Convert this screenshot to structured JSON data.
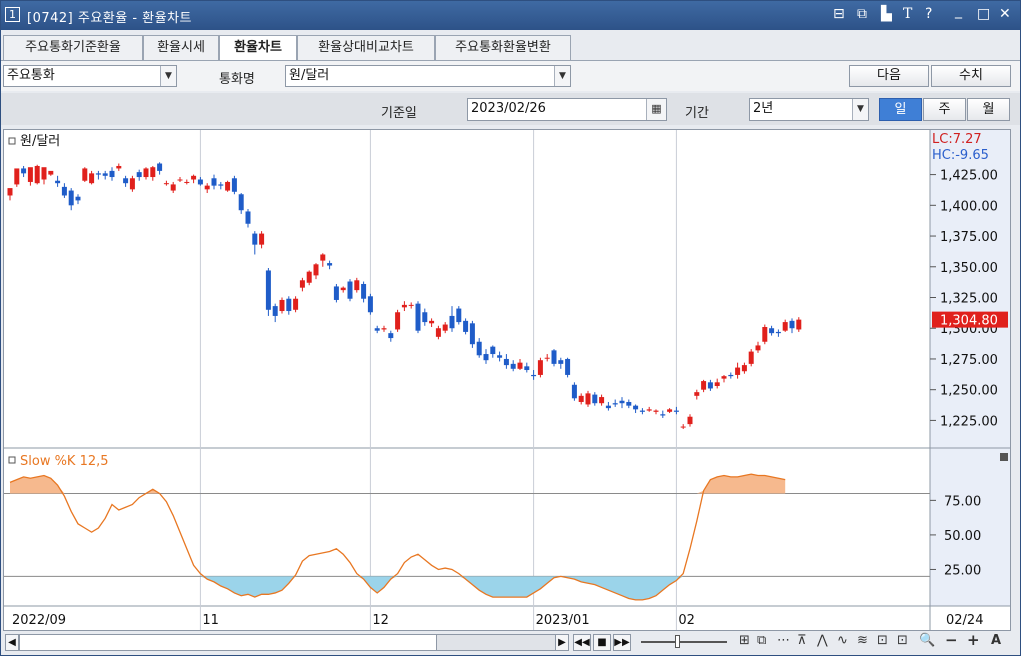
{
  "titlebar": {
    "number": "1",
    "title": "[0742] 주요환율 - 환율차트",
    "controls": [
      "⊟",
      "⧉",
      "▙",
      "T",
      "?",
      "_",
      "□",
      "✕"
    ]
  },
  "tabs": [
    {
      "label": "주요통화기준환율",
      "active": false
    },
    {
      "label": "환율시세",
      "active": false
    },
    {
      "label": "환율차트",
      "active": true
    },
    {
      "label": "환율상대비교차트",
      "active": false
    },
    {
      "label": "주요통화환율변환",
      "active": false
    }
  ],
  "filters": {
    "category_value": "주요통화",
    "currency_label": "통화명",
    "currency_value": "원/달러",
    "next_label": "다음",
    "values_label": "수치",
    "base_date_label": "기준일",
    "base_date_value": "2023/02/26",
    "period_label": "기간",
    "period_value": "2년",
    "period_buttons": [
      {
        "label": "일",
        "active": true
      },
      {
        "label": "주",
        "active": false
      },
      {
        "label": "월",
        "active": false
      }
    ]
  },
  "chart_data": {
    "type": "candlestick",
    "title": "원/달러",
    "lc_label": "LC:7.27",
    "hc_label": "HC:-9.65",
    "current_price_label": "1,304.80",
    "price_ylim": [
      1205,
      1445
    ],
    "price_ticks": [
      "1,425.00",
      "1,400.00",
      "1,375.00",
      "1,350.00",
      "1,325.00",
      "1,300.00",
      "1,275.00",
      "1,250.00",
      "1,225.00"
    ],
    "price_tick_values": [
      1425,
      1400,
      1375,
      1350,
      1325,
      1300,
      1275,
      1250,
      1225
    ],
    "x_labels": [
      "2022/09",
      "11",
      "12",
      "2023/01",
      "02",
      "02/24"
    ],
    "x_label_index": [
      0,
      28,
      53,
      77,
      98,
      130
    ],
    "candles": [
      [
        1408,
        1414,
        1404,
        1412
      ],
      [
        1417,
        1430,
        1415,
        1428
      ],
      [
        1430,
        1426,
        1423,
        1432
      ],
      [
        1419,
        1431,
        1416,
        1429
      ],
      [
        1418,
        1432,
        1417,
        1433
      ],
      [
        1421,
        1431,
        1417,
        1430
      ],
      [
        1425,
        1428,
        1424,
        1427
      ],
      [
        1420,
        1418,
        1415,
        1424
      ],
      [
        1415,
        1408,
        1406,
        1418
      ],
      [
        1412,
        1400,
        1396,
        1414
      ],
      [
        1407,
        1404,
        1401,
        1409
      ],
      [
        1420,
        1430,
        1419,
        1431
      ],
      [
        1418,
        1426,
        1417,
        1428
      ],
      [
        1426,
        1425,
        1421,
        1428
      ],
      [
        1426,
        1424,
        1421,
        1428
      ],
      [
        1428,
        1423,
        1420,
        1431
      ],
      [
        1430,
        1432,
        1428,
        1434
      ],
      [
        1422,
        1418,
        1415,
        1424
      ],
      [
        1413,
        1422,
        1411,
        1424
      ],
      [
        1427,
        1423,
        1420,
        1429
      ],
      [
        1423,
        1430,
        1421,
        1431
      ],
      [
        1423,
        1431,
        1420,
        1432
      ],
      [
        1434,
        1428,
        1425,
        1435
      ],
      [
        1418,
        1418,
        1416,
        1420
      ],
      [
        1412,
        1417,
        1410,
        1419
      ],
      [
        1421,
        1421,
        1419,
        1423
      ],
      [
        1419,
        1419,
        1417,
        1421
      ],
      [
        1421,
        1424,
        1418,
        1425
      ],
      [
        1421,
        1417,
        1416,
        1423
      ],
      [
        1413,
        1416,
        1410,
        1418
      ],
      [
        1422,
        1416,
        1413,
        1425
      ],
      [
        1417,
        1416,
        1413,
        1419
      ],
      [
        1412,
        1419,
        1411,
        1420
      ],
      [
        1422,
        1411,
        1409,
        1424
      ],
      [
        1409,
        1396,
        1393,
        1410
      ],
      [
        1395,
        1385,
        1382,
        1397
      ],
      [
        1377,
        1368,
        1360,
        1379
      ],
      [
        1368,
        1377,
        1365,
        1379
      ],
      [
        1347,
        1315,
        1310,
        1349
      ],
      [
        1318,
        1310,
        1305,
        1320
      ],
      [
        1314,
        1323,
        1312,
        1325
      ],
      [
        1324,
        1314,
        1311,
        1326
      ],
      [
        1315,
        1324,
        1313,
        1326
      ],
      [
        1333,
        1339,
        1330,
        1341
      ],
      [
        1337,
        1346,
        1335,
        1347
      ],
      [
        1343,
        1352,
        1340,
        1353
      ],
      [
        1355,
        1360,
        1350,
        1361
      ],
      [
        1353,
        1351,
        1348,
        1355
      ],
      [
        1334,
        1323,
        1321,
        1336
      ],
      [
        1331,
        1333,
        1329,
        1334
      ],
      [
        1338,
        1324,
        1322,
        1340
      ],
      [
        1331,
        1339,
        1329,
        1341
      ],
      [
        1336,
        1324,
        1321,
        1338
      ],
      [
        1326,
        1313,
        1311,
        1328
      ],
      [
        1300,
        1298,
        1296,
        1302
      ],
      [
        1299,
        1300,
        1297,
        1302
      ],
      [
        1296,
        1292,
        1289,
        1298
      ],
      [
        1299,
        1313,
        1297,
        1315
      ],
      [
        1317,
        1319,
        1314,
        1322
      ],
      [
        1319,
        1319,
        1316,
        1321
      ],
      [
        1320,
        1298,
        1296,
        1322
      ],
      [
        1313,
        1305,
        1302,
        1316
      ],
      [
        1304,
        1306,
        1301,
        1308
      ],
      [
        1293,
        1300,
        1291,
        1302
      ],
      [
        1298,
        1303,
        1296,
        1305
      ],
      [
        1310,
        1300,
        1297,
        1318
      ],
      [
        1316,
        1305,
        1303,
        1318
      ],
      [
        1306,
        1297,
        1295,
        1308
      ],
      [
        1304,
        1287,
        1284,
        1306
      ],
      [
        1289,
        1278,
        1276,
        1292
      ],
      [
        1279,
        1274,
        1271,
        1283
      ],
      [
        1285,
        1279,
        1276,
        1286
      ],
      [
        1278,
        1276,
        1273,
        1281
      ],
      [
        1275,
        1270,
        1267,
        1279
      ],
      [
        1271,
        1267,
        1265,
        1274
      ],
      [
        1267,
        1272,
        1266,
        1275
      ],
      [
        1269,
        1266,
        1264,
        1272
      ],
      [
        1262,
        1261,
        1258,
        1266
      ],
      [
        1262,
        1274,
        1260,
        1276
      ],
      [
        1276,
        1276,
        1273,
        1279
      ],
      [
        1282,
        1271,
        1269,
        1283
      ],
      [
        1274,
        1271,
        1267,
        1276
      ],
      [
        1275,
        1262,
        1260,
        1276
      ],
      [
        1254,
        1243,
        1241,
        1256
      ],
      [
        1240,
        1245,
        1238,
        1247
      ],
      [
        1238,
        1247,
        1236,
        1249
      ],
      [
        1246,
        1239,
        1237,
        1248
      ],
      [
        1239,
        1244,
        1237,
        1246
      ],
      [
        1237,
        1235,
        1233,
        1240
      ],
      [
        1239,
        1238,
        1236,
        1242
      ],
      [
        1241,
        1239,
        1235,
        1244
      ],
      [
        1240,
        1237,
        1235,
        1242
      ],
      [
        1237,
        1234,
        1231,
        1238
      ],
      [
        1233,
        1232,
        1230,
        1235
      ],
      [
        1233,
        1234,
        1232,
        1236
      ],
      [
        1232,
        1233,
        1230,
        1234
      ],
      [
        1230,
        1229,
        1227,
        1233
      ],
      [
        1232,
        1234,
        1231,
        1235
      ],
      [
        1233,
        1232,
        1230,
        1236
      ],
      [
        1220,
        1220,
        1218,
        1222
      ],
      [
        1222,
        1228,
        1220,
        1230
      ],
      [
        1245,
        1248,
        1242,
        1250
      ],
      [
        1250,
        1257,
        1248,
        1258
      ],
      [
        1256,
        1251,
        1249,
        1258
      ],
      [
        1253,
        1256,
        1251,
        1259
      ],
      [
        1259,
        1261,
        1256,
        1262
      ],
      [
        1262,
        1261,
        1259,
        1264
      ],
      [
        1262,
        1268,
        1259,
        1272
      ],
      [
        1265,
        1270,
        1263,
        1272
      ],
      [
        1271,
        1281,
        1269,
        1283
      ],
      [
        1282,
        1286,
        1280,
        1289
      ],
      [
        1289,
        1301,
        1287,
        1303
      ],
      [
        1300,
        1296,
        1294,
        1302
      ],
      [
        1297,
        1296,
        1293,
        1299
      ],
      [
        1298,
        1305,
        1297,
        1307
      ],
      [
        1306,
        1300,
        1296,
        1308
      ],
      [
        1299,
        1307,
        1297,
        1309
      ]
    ],
    "stoch": {
      "label": "Slow %K 12,5",
      "ylim": [
        0,
        110
      ],
      "ticks": [
        "75.00",
        "50.00",
        "25.00"
      ],
      "tick_values": [
        75,
        50,
        25
      ],
      "upper_level": 80,
      "lower_level": 20,
      "values": [
        88,
        90,
        92,
        91,
        92,
        93,
        91,
        86,
        78,
        67,
        58,
        55,
        52,
        55,
        62,
        72,
        68,
        70,
        72,
        77,
        80,
        83,
        80,
        74,
        64,
        52,
        40,
        28,
        22,
        18,
        16,
        13,
        11,
        8,
        6,
        7,
        5,
        7,
        7,
        8,
        10,
        15,
        21,
        31,
        35,
        36,
        37,
        38,
        40,
        36,
        30,
        22,
        18,
        12,
        8,
        12,
        18,
        22,
        30,
        34,
        36,
        32,
        28,
        25,
        26,
        25,
        22,
        18,
        14,
        10,
        7,
        5,
        5,
        5,
        5,
        5,
        5,
        8,
        11,
        15,
        19,
        20,
        19,
        18,
        16,
        15,
        14,
        12,
        10,
        8,
        6,
        4,
        3,
        3,
        4,
        6,
        10,
        14,
        17,
        22,
        40,
        60,
        82,
        90,
        92,
        93,
        92,
        92,
        93,
        94,
        93,
        93,
        92,
        91,
        90
      ]
    }
  },
  "bottom": {
    "scroll_left": "◀",
    "scroll_right": "▶",
    "nav": [
      "◀◀",
      "■",
      "▶▶"
    ],
    "tools": [
      "⊞",
      "⧉",
      "⋯",
      "⊼",
      "⋀",
      "∿",
      "≋",
      "⊡",
      "⊡",
      "🔍",
      "−",
      "+",
      "A"
    ]
  }
}
